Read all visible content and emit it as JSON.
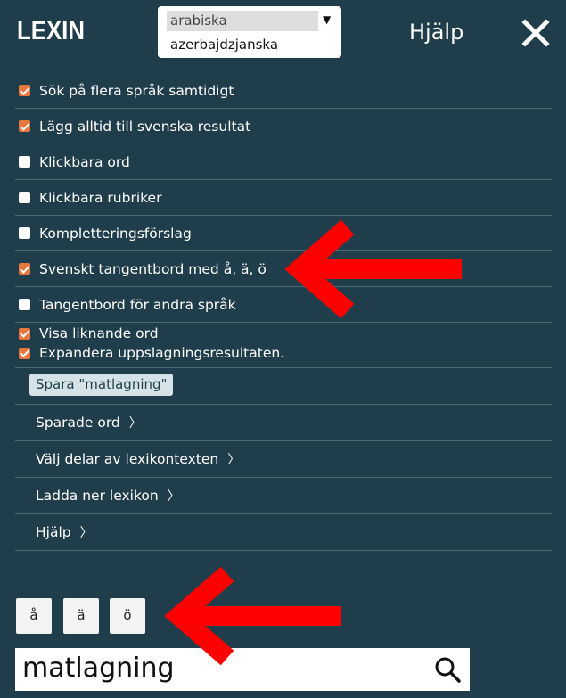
{
  "header": {
    "logo": "LEXIN",
    "language_options": [
      "arabiska",
      "azerbajdzjanska"
    ],
    "help_title": "Hjälp"
  },
  "settings": [
    {
      "label": "Sök på flera språk samtidigt",
      "checked": true
    },
    {
      "label": "Lägg alltid till svenska resultat",
      "checked": true
    },
    {
      "label": "Klickbara ord",
      "checked": false
    },
    {
      "label": "Klickbara rubriker",
      "checked": false
    },
    {
      "label": "Kompletteringsförslag",
      "checked": false
    },
    {
      "label": "Svenskt tangentbord med å, ä, ö",
      "checked": true
    },
    {
      "label": "Tangentbord för andra språk",
      "checked": false
    },
    {
      "label": "Visa liknande ord",
      "checked": true
    },
    {
      "label": "Expandera uppslagningsresultaten.",
      "checked": true
    }
  ],
  "save_button": "Spara \"matlagning\"",
  "links": [
    "Sparade ord",
    "Välj delar av lexikontexten",
    "Ladda ner lexikon",
    "Hjälp"
  ],
  "chevron": "〉",
  "keyboard": [
    "å",
    "ä",
    "ö"
  ],
  "search": {
    "value": "matlagning"
  },
  "colors": {
    "background": "#1f3d4a",
    "checkbox_checked": "#e8773e",
    "annotation_arrow": "#ff0000"
  }
}
